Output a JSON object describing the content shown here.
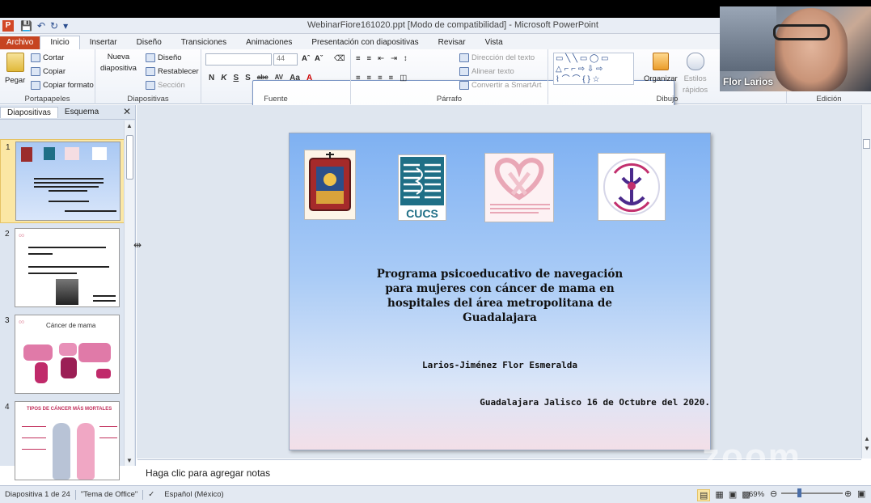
{
  "window": {
    "title": "WebinarFiore161020.ppt [Modo de compatibilidad]  -  Microsoft PowerPoint",
    "app_letter": "P"
  },
  "tabs": [
    "Archivo",
    "Inicio",
    "Insertar",
    "Diseño",
    "Transiciones",
    "Animaciones",
    "Presentación con diapositivas",
    "Revisar",
    "Vista"
  ],
  "ribbon": {
    "portapapeles": {
      "label": "Portapapeles",
      "pegar": "Pegar",
      "cortar": "Cortar",
      "copiar": "Copiar",
      "copiar_formato": "Copiar formato"
    },
    "diapositivas": {
      "label": "Diapositivas",
      "nueva": "Nueva",
      "diapositiva": "diapositiva",
      "diseno": "Diseño",
      "restablecer": "Restablecer",
      "seccion": "Sección"
    },
    "fuente": {
      "label": "Fuente",
      "size": "44"
    },
    "parrafo": {
      "label": "Párrafo",
      "direccion": "Dirección del texto",
      "alinear": "Alinear texto",
      "smartart": "Convertir a SmartArt"
    },
    "dibujo": {
      "label": "Dibujo",
      "organizar": "Organizar",
      "estilos": "Estilos",
      "rapidos": "rápidos"
    },
    "edicion": {
      "label": "Edición"
    }
  },
  "left_pane": {
    "tab_diapositivas": "Diapositivas",
    "tab_esquema": "Esquema",
    "thumbnails": [
      {
        "num": "1",
        "heading": ""
      },
      {
        "num": "2",
        "heading": ""
      },
      {
        "num": "3",
        "heading": "Cáncer de mama"
      },
      {
        "num": "4",
        "heading": "TIPOS DE CÁNCER MÁS MORTALES"
      }
    ]
  },
  "slide": {
    "title_line1": "Programa psicoeducativo de navegación",
    "title_line2": "para mujeres con cáncer de mama en",
    "title_line3": "hospitales del área metropolitana de",
    "title_line4": "Guadalajara",
    "author": "Larios-Jiménez Flor Esmeralda",
    "date": "Guadalajara Jalisco 16 de Octubre del 2020.",
    "logos": [
      {
        "name": "universidad-de-guadalajara-logo",
        "text": ""
      },
      {
        "name": "cucs-logo",
        "text": "CUCS"
      },
      {
        "name": "programa-navegacion-logo",
        "text": ""
      },
      {
        "name": "maestria-psicologia-logo",
        "text": ""
      }
    ]
  },
  "notes": {
    "placeholder": "Haga clic para agregar notas"
  },
  "statusbar": {
    "slide_info": "Diapositiva 1 de 24",
    "theme": "\"Tema de Office\"",
    "language": "Español (México)",
    "zoom": "69%"
  },
  "webcam": {
    "name": "Flor Larios"
  },
  "watermark": "zoom",
  "colors": {
    "file_tab": "#c64421",
    "ribbon_bg": "#eef2f8",
    "slide_top": "#7fb1f2",
    "selection": "#fbe7a4"
  }
}
